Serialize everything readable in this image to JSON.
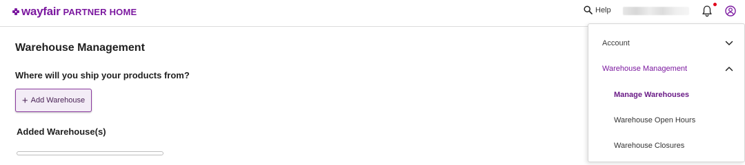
{
  "header": {
    "brand": {
      "wordmark": "wayfair",
      "subtitle": "PARTNER HOME",
      "color": "#7b189f"
    },
    "help_label": "Help",
    "icons": {
      "help": "search-icon",
      "notifications": "bell-icon",
      "account": "account-circle-icon"
    },
    "notification_dot_color": "#e2001a"
  },
  "main": {
    "page_title": "Warehouse Management",
    "question": "Where will you ship your products from?",
    "add_button_label": "Add Warehouse",
    "added_section_title": "Added Warehouse(s)"
  },
  "menu": {
    "items": [
      {
        "label": "Account",
        "expanded": false,
        "icon": "chevron-down-icon"
      },
      {
        "label": "Warehouse Management",
        "expanded": true,
        "icon": "chevron-up-icon"
      },
      {
        "label": "Manage Warehouses",
        "selected": true
      },
      {
        "label": "Warehouse Open Hours"
      },
      {
        "label": "Warehouse Closures"
      }
    ]
  },
  "colors": {
    "accent": "#7b189f",
    "accent_dark": "#4a2356",
    "button_bg": "#f3ecf6"
  }
}
